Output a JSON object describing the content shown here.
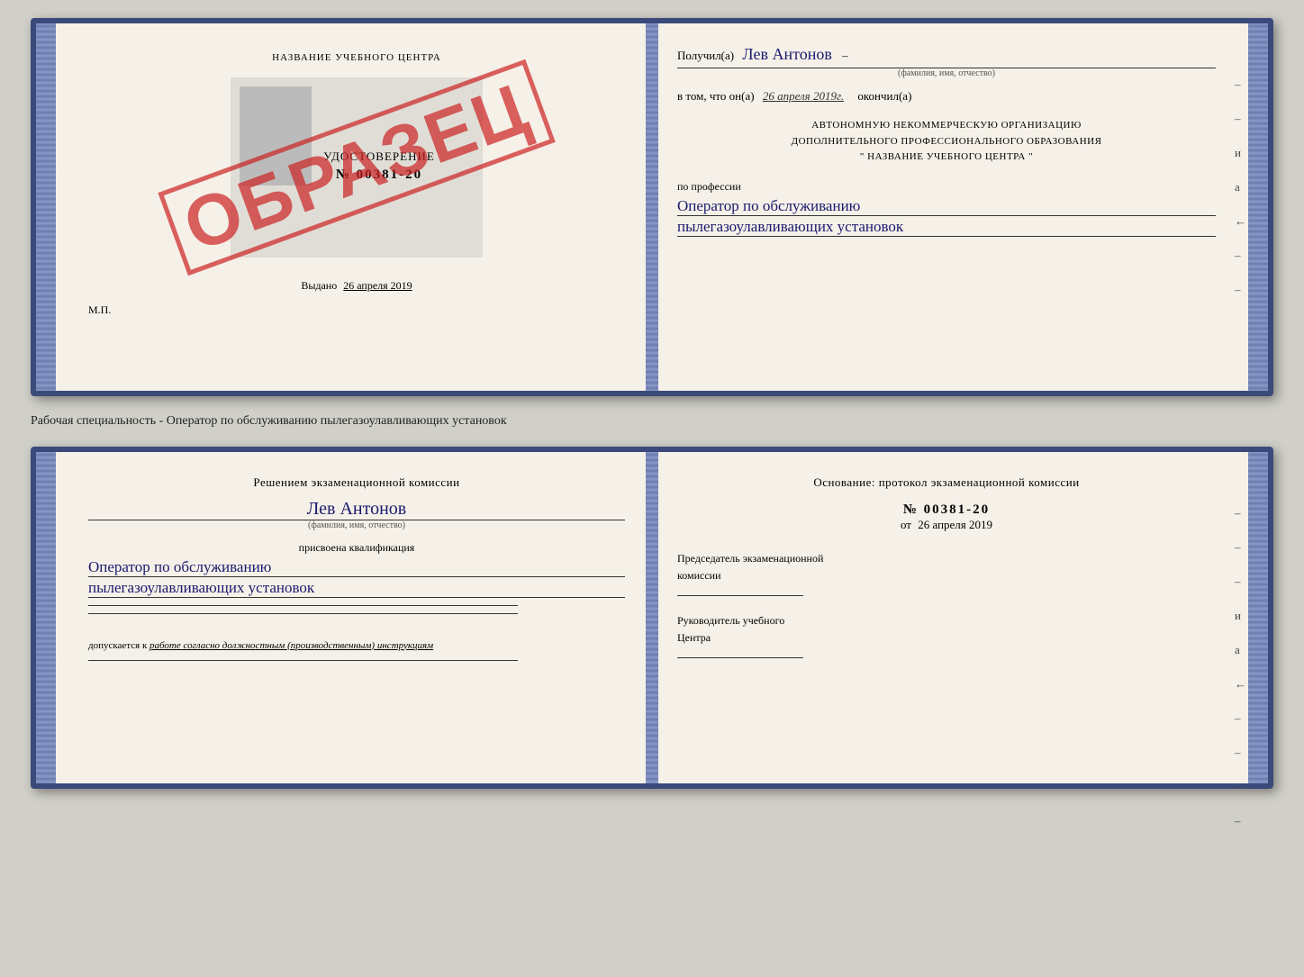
{
  "top_cert": {
    "left": {
      "school_name": "НАЗВАНИЕ УЧЕБНОГО ЦЕНТРА",
      "cert_label": "УДОСТОВЕРЕНИЕ",
      "cert_number": "№ 00381-20",
      "issued_label": "Выдано",
      "issued_date": "26 апреля 2019",
      "mp_label": "М.П.",
      "obrazets": "ОБРАЗЕЦ"
    },
    "right": {
      "received_prefix": "Получил(а)",
      "recipient_name": "Лев Антонов",
      "fio_label": "(фамилия, имя, отчество)",
      "date_prefix": "в том, что он(а)",
      "date_value": "26 апреля 2019г.",
      "finished_label": "окончил(а)",
      "org_line1": "АВТОНОМНУЮ НЕКОММЕРЧЕСКУЮ ОРГАНИЗАЦИЮ",
      "org_line2": "ДОПОЛНИТЕЛЬНОГО ПРОФЕССИОНАЛЬНОГО ОБРАЗОВАНИЯ",
      "org_line3": "\"   НАЗВАНИЕ УЧЕБНОГО ЦЕНТРА   \"",
      "profession_prefix": "по профессии",
      "profession_line1": "Оператор по обслуживанию",
      "profession_line2": "пылегазоулавливающих установок"
    }
  },
  "middle_label": "Рабочая специальность - Оператор по обслуживанию пылегазоулавливающих установок",
  "bottom_cert": {
    "left": {
      "commission_text1": "Решением экзаменационной комиссии",
      "recipient_name": "Лев Антонов",
      "fio_label": "(фамилия, имя, отчество)",
      "qual_assigned": "присвоена квалификация",
      "qual_line1": "Оператор по обслуживанию",
      "qual_line2": "пылегазоулавливающих установок",
      "allow_prefix": "допускается к",
      "allow_text": "работе согласно должностным (производственным) инструкциям"
    },
    "right": {
      "basis_text": "Основание: протокол экзаменационной комиссии",
      "protocol_number": "№ 00381-20",
      "protocol_date_prefix": "от",
      "protocol_date": "26 апреля 2019",
      "chairman_label1": "Председатель экзаменационной",
      "chairman_label2": "комиссии",
      "director_label1": "Руководитель учебного",
      "director_label2": "Центра"
    }
  },
  "side_marks": {
    "marks": [
      "–",
      "–",
      "–",
      "и",
      "а",
      "←",
      "–",
      "–",
      "–",
      "–"
    ]
  }
}
